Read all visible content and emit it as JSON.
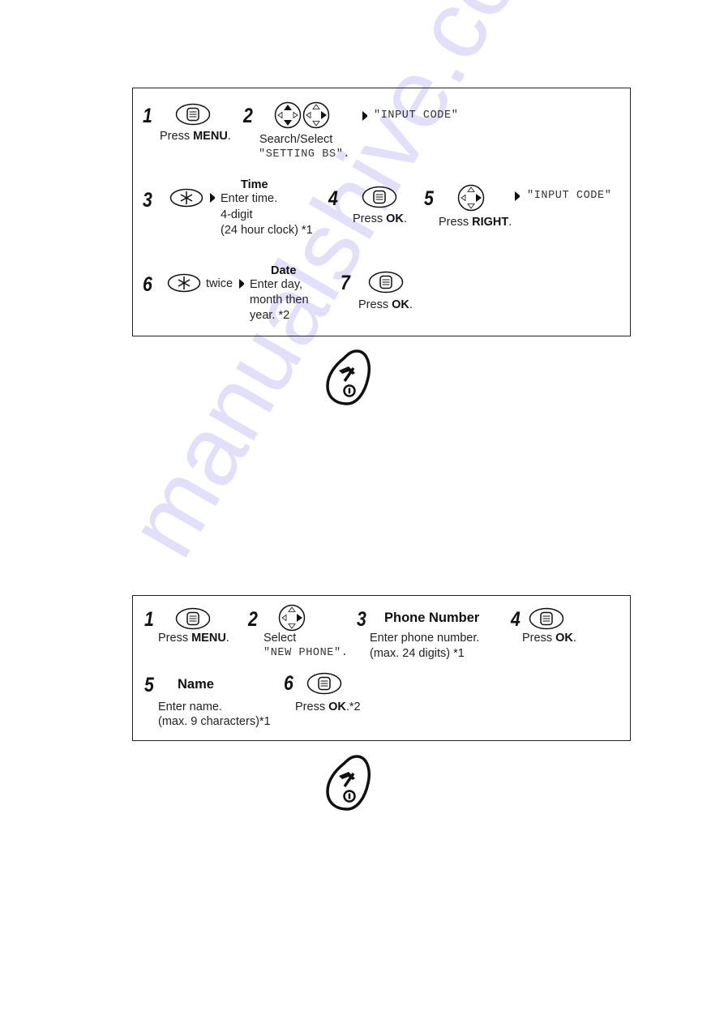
{
  "watermark": "manualshive.com",
  "box1": {
    "steps": [
      {
        "num": "1",
        "icon": "menu-button-icon",
        "pre": "Press ",
        "bold": "MENU",
        "post": "."
      },
      {
        "num": "2",
        "icon": "navigator-up-down-icon",
        "line1": "Search/Select",
        "line2": "\"SETTING BS\".",
        "result": "\"INPUT CODE\""
      },
      {
        "num": "3",
        "icon": "star-key-icon",
        "heading": "Time",
        "line1": "Enter time.",
        "line2": "4-digit",
        "line3": "(24 hour clock) *1"
      },
      {
        "num": "4",
        "icon": "ok-button-icon",
        "pre": "Press ",
        "bold": "OK",
        "post": "."
      },
      {
        "num": "5",
        "icon": "navigator-right-icon",
        "pre": "Press ",
        "bold": "RIGHT",
        "post": ".",
        "result": "\"INPUT CODE\""
      },
      {
        "num": "6",
        "icon": "star-key-icon",
        "suffix": "twice",
        "heading": "Date",
        "line1": "Enter day,",
        "line2": "month then",
        "line3": "year. *2"
      },
      {
        "num": "7",
        "icon": "ok-button-icon",
        "pre": "Press ",
        "bold": "OK",
        "post": "."
      }
    ]
  },
  "end_icon_1": "end-call-power-button-icon",
  "box2": {
    "steps": [
      {
        "num": "1",
        "icon": "menu-button-icon",
        "pre": "Press ",
        "bold": "MENU",
        "post": "."
      },
      {
        "num": "2",
        "icon": "navigator-right-icon",
        "line1": "Select",
        "line2": "\"NEW PHONE\"."
      },
      {
        "num": "3",
        "heading": "Phone Number",
        "line1": "Enter phone number.",
        "line2": "(max. 24 digits) *1"
      },
      {
        "num": "4",
        "icon": "ok-button-icon",
        "pre": "Press ",
        "bold": "OK",
        "post": "."
      },
      {
        "num": "5",
        "heading": "Name",
        "line1": "Enter name.",
        "line2": "(max. 9 characters)*1"
      },
      {
        "num": "6",
        "icon": "ok-button-icon",
        "pre": "Press ",
        "bold": "OK",
        "post": ".*2"
      }
    ]
  },
  "end_icon_2": "end-call-power-button-icon"
}
